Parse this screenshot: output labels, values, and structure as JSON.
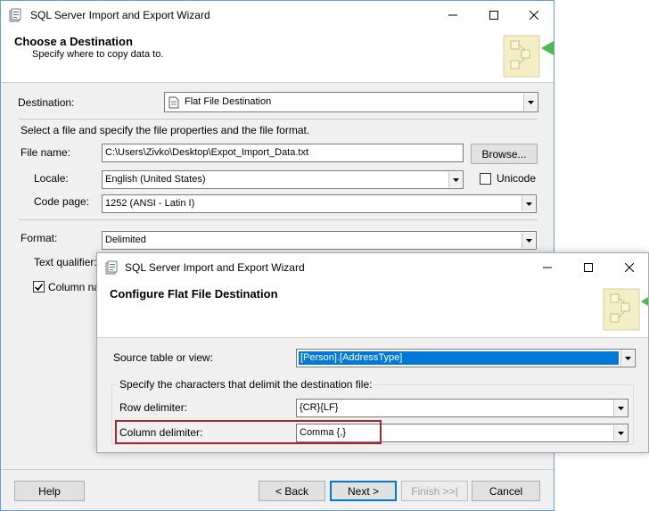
{
  "main": {
    "title": "SQL Server Import and Export Wizard",
    "header_title": "Choose a Destination",
    "header_subtitle": "Specify where to copy data to.",
    "destination_label": "Destination:",
    "destination_value": "Flat File Destination",
    "file_instructions": "Select a file and specify the file properties and the file format.",
    "file_name_label": "File name:",
    "file_name_value": "C:\\Users\\Zivko\\Desktop\\Expot_Import_Data.txt",
    "browse_label": "Browse...",
    "locale_label": "Locale:",
    "locale_value": "English (United States)",
    "unicode_label": "Unicode",
    "code_page_label": "Code page:",
    "code_page_value": "1252  (ANSI - Latin I)",
    "format_label": "Format:",
    "format_value": "Delimited",
    "text_qualifier_label": "Text qualifier:",
    "column_names_label": "Column nar",
    "help_label": "Help",
    "back_label": "< Back",
    "next_label": "Next >",
    "finish_label": "Finish >>|",
    "cancel_label": "Cancel"
  },
  "dialog": {
    "title": "SQL Server Import and Export Wizard",
    "header_title": "Configure Flat File Destination",
    "source_label": "Source table or view:",
    "source_value": "[Person].[AddressType]",
    "group_title": "Specify the characters that delimit the destination file:",
    "row_delim_label": "Row delimiter:",
    "row_delim_value": "{CR}{LF}",
    "col_delim_label": "Column delimiter:",
    "col_delim_value": "Comma {,}"
  },
  "colors": {
    "selection": "#0078d7",
    "highlight_box": "#a52a2a"
  }
}
